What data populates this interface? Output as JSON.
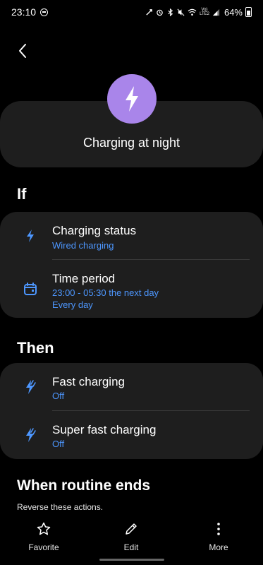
{
  "status_bar": {
    "time": "23:10",
    "network_label_top": "Vo)",
    "network_label_bottom": "LTE2",
    "battery_percent": "64%"
  },
  "header": {
    "routine_name": "Charging at night",
    "icon": "lightning-bolt-icon",
    "accent_color": "#a985ea"
  },
  "if_section": {
    "title": "If",
    "conditions": [
      {
        "title": "Charging status",
        "lines": [
          "Wired charging"
        ],
        "icon": "lightning-bolt-icon"
      },
      {
        "title": "Time period",
        "lines": [
          "23:00 - 05:30 the next day",
          "Every day"
        ],
        "icon": "calendar-icon"
      }
    ]
  },
  "then_section": {
    "title": "Then",
    "actions": [
      {
        "title": "Fast charging",
        "lines": [
          "Off"
        ],
        "icon": "fast-charging-icon"
      },
      {
        "title": "Super fast charging",
        "lines": [
          "Off"
        ],
        "icon": "fast-charging-icon"
      }
    ]
  },
  "when_ends": {
    "title": "When routine ends",
    "subtitle": "Reverse these actions."
  },
  "bottom_bar": {
    "favorite_label": "Favorite",
    "edit_label": "Edit",
    "more_label": "More"
  },
  "colors": {
    "background": "#000000",
    "card": "#1e1e1e",
    "link_blue": "#4d97ff"
  }
}
